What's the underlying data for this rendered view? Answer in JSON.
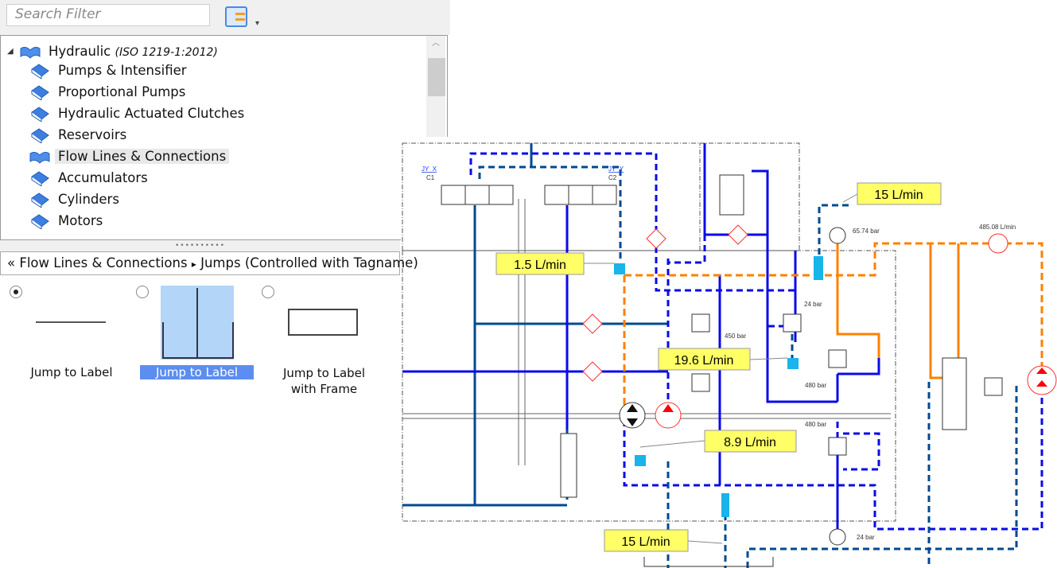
{
  "toolbar": {
    "search_placeholder": "Search Filter",
    "filter_icon": "checklist-icon",
    "dropdown_icon": "chevron-down-icon"
  },
  "tree": {
    "root": {
      "label": "Hydraulic",
      "standard": "(ISO 1219-1:2012)"
    },
    "items": [
      {
        "label": "Pumps & Intensifier"
      },
      {
        "label": "Proportional Pumps"
      },
      {
        "label": "Hydraulic Actuated Clutches"
      },
      {
        "label": "Reservoirs"
      },
      {
        "label": "Flow Lines & Connections",
        "selected": true
      },
      {
        "label": "Accumulators"
      },
      {
        "label": "Cylinders"
      },
      {
        "label": "Motors"
      }
    ]
  },
  "breadcrumb": {
    "back": "«",
    "parent": "Flow Lines & Connections",
    "separator": "▸",
    "current": "Jumps (Controlled with Tagname)"
  },
  "palette": [
    {
      "label": "Jump to Label",
      "radio_checked": true
    },
    {
      "label": "Jump to Label",
      "radio_checked": false,
      "highlighted": true
    },
    {
      "label": "Jump to Label with Frame",
      "line1": "Jump to Label",
      "line2": "with Frame",
      "radio_checked": false
    }
  ],
  "diagram": {
    "flow_labels": [
      "1.5 L/min",
      "15 L/min",
      "19.6 L/min",
      "8.9 L/min",
      "15 L/min"
    ],
    "tags": {
      "c1_link": "JY_X",
      "c1": "C1",
      "c2_link": "JY_Y",
      "c2": "C2"
    },
    "readouts": {
      "p450": "450 bar",
      "p24a": "24 bar",
      "p480a": "480 bar",
      "p65": "65.74 bar",
      "flow485": "485.08 L/min",
      "p480b": "480 bar",
      "p24b": "24 bar"
    },
    "colors": {
      "dark_blue": "#004a8f",
      "blue": "#0a0ae8",
      "orange": "#ff8000",
      "red": "#ff3030",
      "tank": "#18b4ea",
      "label_bg": "#ffff66"
    }
  }
}
